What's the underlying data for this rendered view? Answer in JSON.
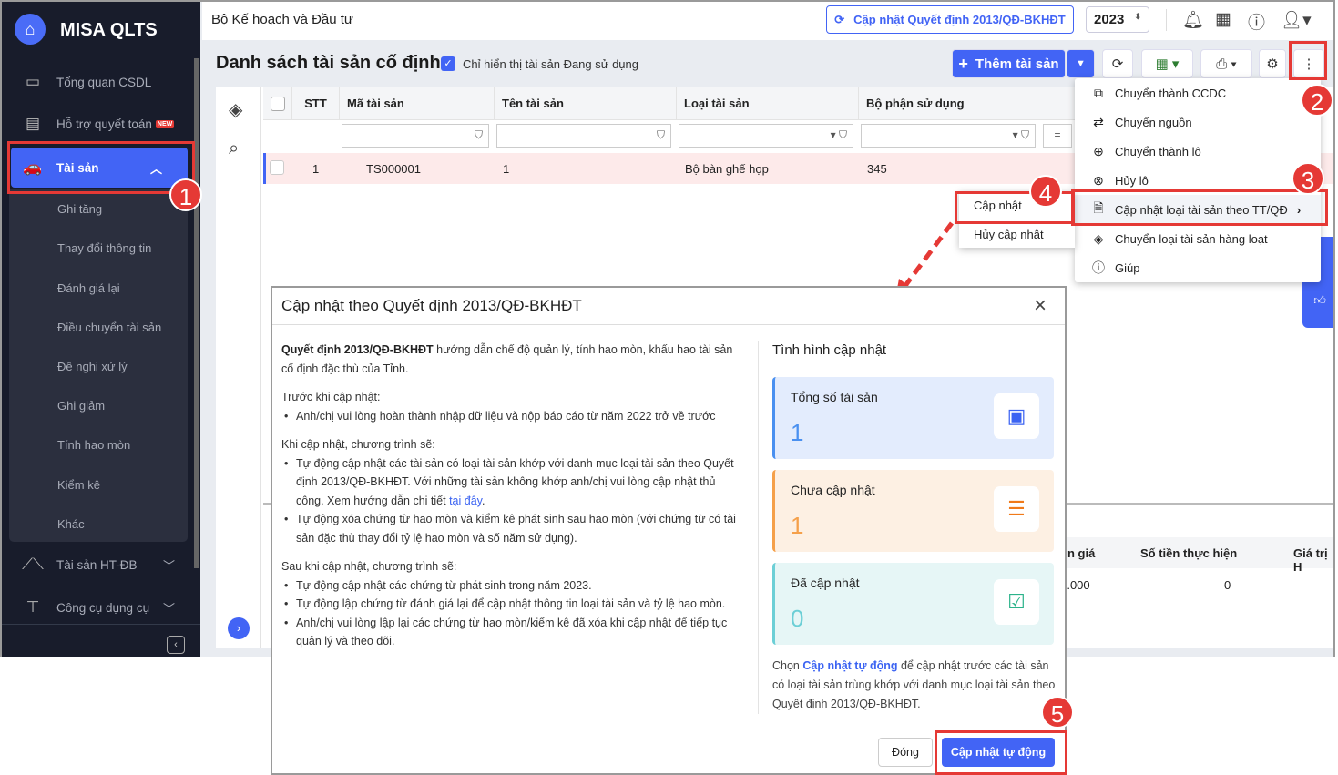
{
  "app": {
    "name": "MISA QLTS",
    "org": "Bộ Kế hoạch và Đầu tư",
    "update_decision_button": "Cập nhật Quyết định 2013/QĐ-BKHĐT",
    "year": "2023"
  },
  "sidebar": {
    "items": [
      {
        "label": "Tổng quan CSDL"
      },
      {
        "label": "Hỗ trợ quyết toán",
        "badge": "NEW"
      },
      {
        "label": "Tài sản"
      },
      {
        "label": "Tài sản HT-ĐB"
      },
      {
        "label": "Công cụ dụng cụ"
      }
    ],
    "sub_items": [
      "Ghi tăng",
      "Thay đổi thông tin",
      "Đánh giá lại",
      "Điều chuyển tài sản",
      "Đề nghị xử lý",
      "Ghi giảm",
      "Tính hao mòn",
      "Kiểm kê",
      "Khác"
    ]
  },
  "page": {
    "title": "Danh sách tài sản cố định",
    "filter_label": "Chỉ hiển thị tài sản Đang sử dụng",
    "add_button": "Thêm tài sản"
  },
  "table": {
    "columns": [
      "STT",
      "Mã tài sản",
      "Tên tài sản",
      "Loại tài sản",
      "Bộ phận sử dụng"
    ],
    "filter_eq": "=",
    "rows": [
      {
        "stt": "1",
        "code": "TS000001",
        "name": "1",
        "type": "Bộ bàn ghế họp",
        "dept": "345"
      }
    ]
  },
  "detail_table": {
    "columns": [
      "n giá",
      "Số tiền thực hiện",
      "Giá trị H"
    ],
    "row": [
      ").000",
      "0",
      ""
    ]
  },
  "more_menu": {
    "items": [
      "Chuyển thành CCDC",
      "Chuyển nguồn",
      "Chuyển thành lô",
      "Hủy lô",
      "Cập nhật loại tài sản theo TT/QĐ",
      "Chuyển loại tài sản hàng loạt",
      "Giúp"
    ]
  },
  "submenu": {
    "items": [
      "Cập nhật",
      "Hủy cập nhật"
    ]
  },
  "annotations": [
    "1",
    "2",
    "3",
    "4",
    "5"
  ],
  "dialog": {
    "title": "Cập nhật theo Quyết định 2013/QĐ-BKHĐT",
    "intro_bold": "Quyết định 2013/QĐ-BKHĐT",
    "intro_rest": " hướng dẫn chế độ quản lý, tính hao mòn, khấu hao tài sản cố định đặc thù của Tỉnh.",
    "before_title": "Trước khi cập nhật:",
    "before_items": [
      "Anh/chị vui lòng hoàn thành nhập dữ liệu và nộp báo cáo từ năm 2022 trở về trước"
    ],
    "during_title": "Khi cập nhật, chương trình sẽ:",
    "during_item1": "Tự động cập nhật các tài sản có loại tài sản khớp với danh mục loại tài sản theo Quyết định 2013/QĐ-BKHĐT. Với những tài sản không khớp anh/chị vui lòng cập nhật thủ công. Xem hướng dẫn chi tiết ",
    "during_link": "tại đây",
    "during_item2": "Tự động xóa chứng từ hao mòn và kiểm kê phát sinh sau hao mòn (với chứng từ có tài sản đặc thù thay đổi tỷ lệ hao mòn và số năm sử dụng).",
    "after_title": "Sau khi cập nhật, chương trình sẽ:",
    "after_items": [
      "Tự động cập nhật các chứng từ phát sinh trong năm 2023.",
      "Tự động lập chứng từ đánh giá lại để cập nhật thông tin loại tài sản và tỷ lệ hao mòn.",
      "Anh/chị vui lòng lập lại các chứng từ hao mòn/kiểm kê đã xóa khi cập nhật để tiếp tục quản lý và theo dõi."
    ],
    "status_title": "Tình hình cập nhật",
    "cards": [
      {
        "label": "Tổng số tài sản",
        "value": "1",
        "color": "#4a90f0"
      },
      {
        "label": "Chưa cập nhật",
        "value": "1",
        "color": "#f5a04a"
      },
      {
        "label": "Đã cập nhật",
        "value": "0",
        "color": "#6ccfd6"
      }
    ],
    "note_pre": "Chọn ",
    "note_link": "Cập nhật tự động",
    "note_post": " để cập nhật trước các tài sản có loại tài sản trùng khớp với danh mục loại tài sản theo Quyết định 2013/QĐ-BKHĐT.",
    "close_button": "Đóng",
    "auto_update_button": "Cập nhật tự động"
  }
}
